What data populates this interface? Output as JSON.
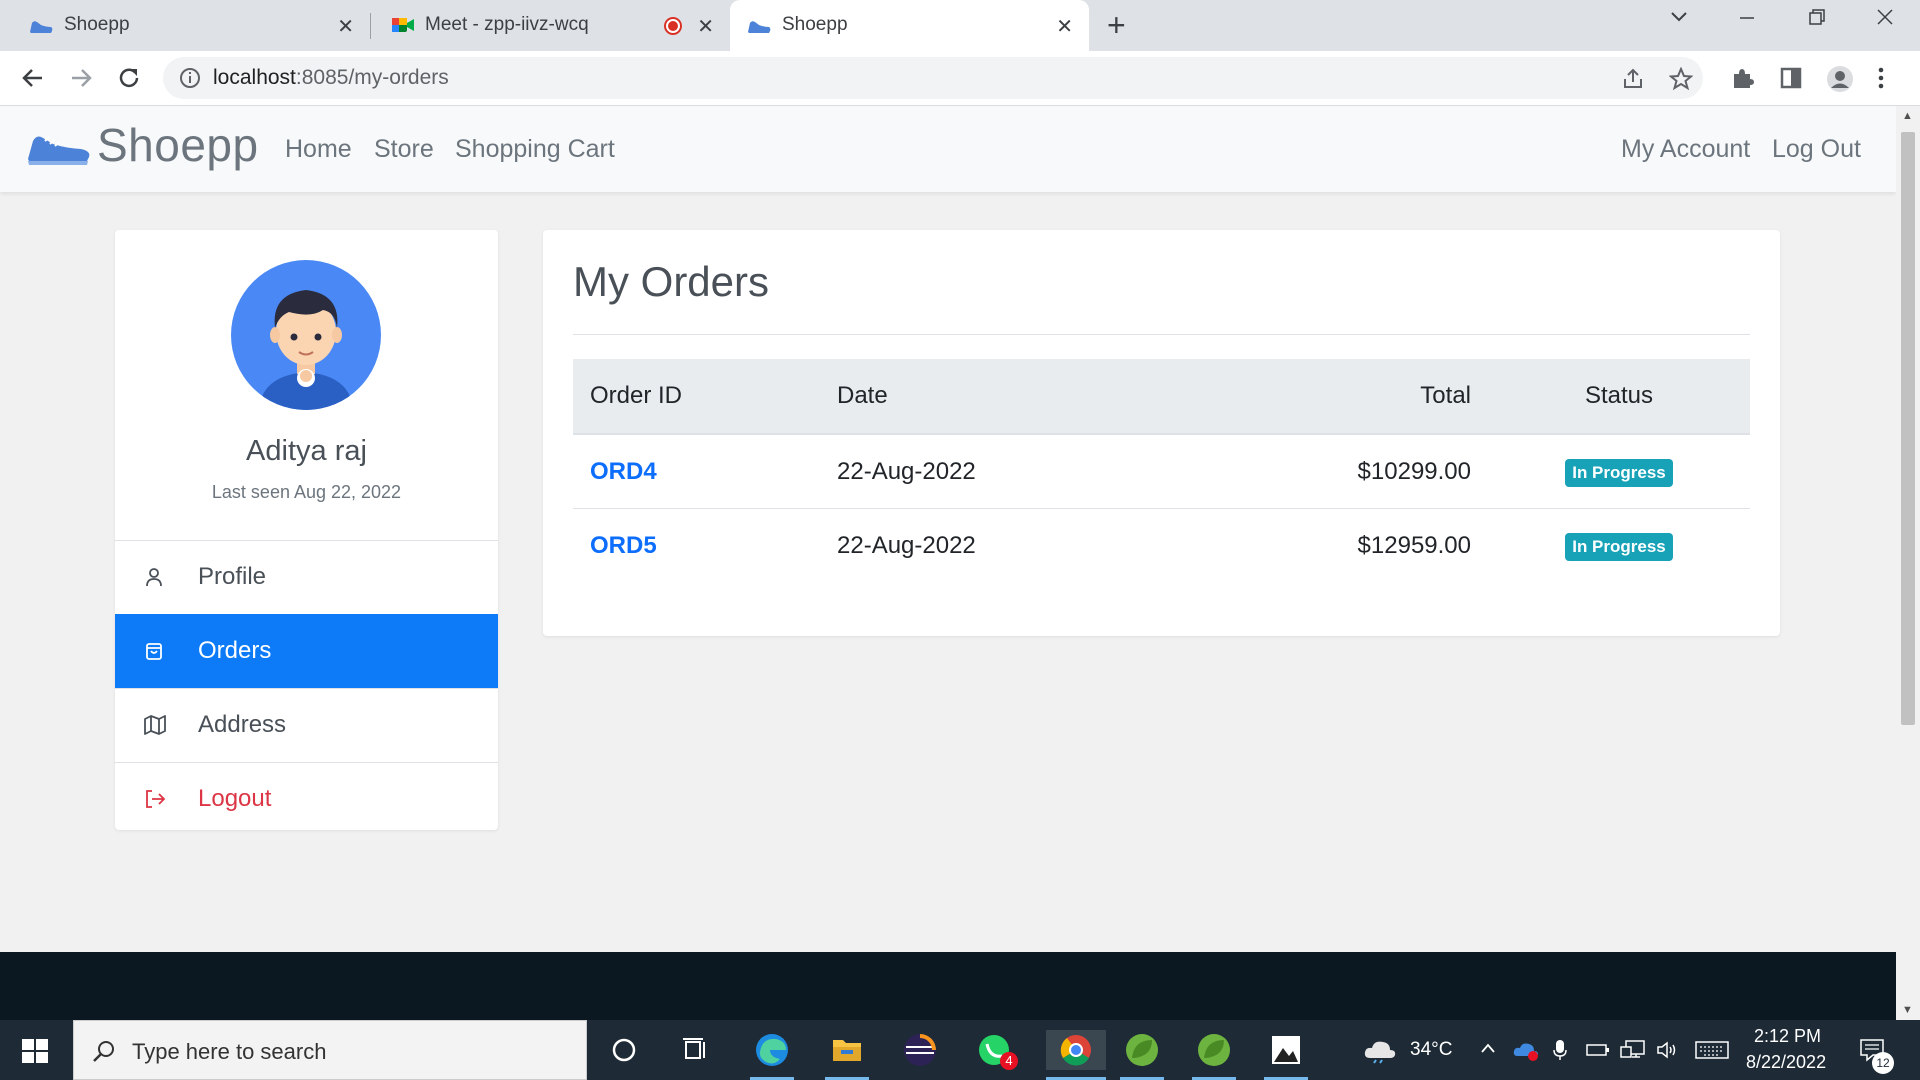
{
  "browser": {
    "tabs": [
      {
        "title": "Shoepp",
        "active": false
      },
      {
        "title": "Meet - zpp-iivz-wcq",
        "active": false,
        "recording": true
      },
      {
        "title": "Shoepp",
        "active": true
      }
    ],
    "url_host": "localhost",
    "url_path": ":8085/my-orders"
  },
  "navbar": {
    "brand": "Shoepp",
    "links": [
      "Home",
      "Store",
      "Shopping Cart"
    ],
    "right_links": [
      "My Account",
      "Log Out"
    ]
  },
  "profile": {
    "name": "Aditya raj",
    "last_seen": "Last seen Aug 22, 2022"
  },
  "menu": [
    {
      "label": "Profile",
      "icon": "user-icon",
      "active": false
    },
    {
      "label": "Orders",
      "icon": "bag-icon",
      "active": true
    },
    {
      "label": "Address",
      "icon": "map-icon",
      "active": false
    },
    {
      "label": "Logout",
      "icon": "logout-icon",
      "active": false
    }
  ],
  "orders": {
    "title": "My Orders",
    "columns": [
      "Order ID",
      "Date",
      "Total",
      "Status"
    ],
    "rows": [
      {
        "id": "ORD4",
        "date": "22-Aug-2022",
        "total": "$10299.00",
        "status": "In Progress"
      },
      {
        "id": "ORD5",
        "date": "22-Aug-2022",
        "total": "$12959.00",
        "status": "In Progress"
      }
    ]
  },
  "taskbar": {
    "search_placeholder": "Type here to search",
    "temperature": "34°C",
    "time": "2:12 PM",
    "date": "8/22/2022",
    "whatsapp_badge": "4",
    "notification_count": "12"
  },
  "colors": {
    "primary": "#0d7bf7",
    "status_badge": "#17a2b8",
    "danger": "#dc3545"
  }
}
